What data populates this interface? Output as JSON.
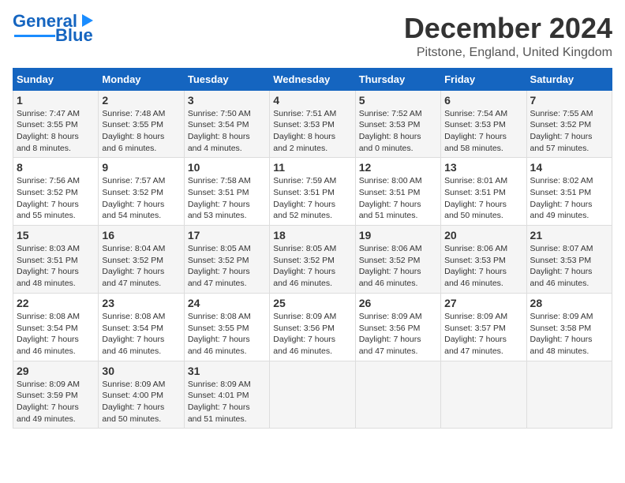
{
  "logo": {
    "line1": "General",
    "line2": "Blue"
  },
  "header": {
    "title": "December 2024",
    "subtitle": "Pitstone, England, United Kingdom"
  },
  "columns": [
    "Sunday",
    "Monday",
    "Tuesday",
    "Wednesday",
    "Thursday",
    "Friday",
    "Saturday"
  ],
  "weeks": [
    [
      {
        "day": "1",
        "lines": [
          "Sunrise: 7:47 AM",
          "Sunset: 3:55 PM",
          "Daylight: 8 hours",
          "and 8 minutes."
        ]
      },
      {
        "day": "2",
        "lines": [
          "Sunrise: 7:48 AM",
          "Sunset: 3:55 PM",
          "Daylight: 8 hours",
          "and 6 minutes."
        ]
      },
      {
        "day": "3",
        "lines": [
          "Sunrise: 7:50 AM",
          "Sunset: 3:54 PM",
          "Daylight: 8 hours",
          "and 4 minutes."
        ]
      },
      {
        "day": "4",
        "lines": [
          "Sunrise: 7:51 AM",
          "Sunset: 3:53 PM",
          "Daylight: 8 hours",
          "and 2 minutes."
        ]
      },
      {
        "day": "5",
        "lines": [
          "Sunrise: 7:52 AM",
          "Sunset: 3:53 PM",
          "Daylight: 8 hours",
          "and 0 minutes."
        ]
      },
      {
        "day": "6",
        "lines": [
          "Sunrise: 7:54 AM",
          "Sunset: 3:53 PM",
          "Daylight: 7 hours",
          "and 58 minutes."
        ]
      },
      {
        "day": "7",
        "lines": [
          "Sunrise: 7:55 AM",
          "Sunset: 3:52 PM",
          "Daylight: 7 hours",
          "and 57 minutes."
        ]
      }
    ],
    [
      {
        "day": "8",
        "lines": [
          "Sunrise: 7:56 AM",
          "Sunset: 3:52 PM",
          "Daylight: 7 hours",
          "and 55 minutes."
        ]
      },
      {
        "day": "9",
        "lines": [
          "Sunrise: 7:57 AM",
          "Sunset: 3:52 PM",
          "Daylight: 7 hours",
          "and 54 minutes."
        ]
      },
      {
        "day": "10",
        "lines": [
          "Sunrise: 7:58 AM",
          "Sunset: 3:51 PM",
          "Daylight: 7 hours",
          "and 53 minutes."
        ]
      },
      {
        "day": "11",
        "lines": [
          "Sunrise: 7:59 AM",
          "Sunset: 3:51 PM",
          "Daylight: 7 hours",
          "and 52 minutes."
        ]
      },
      {
        "day": "12",
        "lines": [
          "Sunrise: 8:00 AM",
          "Sunset: 3:51 PM",
          "Daylight: 7 hours",
          "and 51 minutes."
        ]
      },
      {
        "day": "13",
        "lines": [
          "Sunrise: 8:01 AM",
          "Sunset: 3:51 PM",
          "Daylight: 7 hours",
          "and 50 minutes."
        ]
      },
      {
        "day": "14",
        "lines": [
          "Sunrise: 8:02 AM",
          "Sunset: 3:51 PM",
          "Daylight: 7 hours",
          "and 49 minutes."
        ]
      }
    ],
    [
      {
        "day": "15",
        "lines": [
          "Sunrise: 8:03 AM",
          "Sunset: 3:51 PM",
          "Daylight: 7 hours",
          "and 48 minutes."
        ]
      },
      {
        "day": "16",
        "lines": [
          "Sunrise: 8:04 AM",
          "Sunset: 3:52 PM",
          "Daylight: 7 hours",
          "and 47 minutes."
        ]
      },
      {
        "day": "17",
        "lines": [
          "Sunrise: 8:05 AM",
          "Sunset: 3:52 PM",
          "Daylight: 7 hours",
          "and 47 minutes."
        ]
      },
      {
        "day": "18",
        "lines": [
          "Sunrise: 8:05 AM",
          "Sunset: 3:52 PM",
          "Daylight: 7 hours",
          "and 46 minutes."
        ]
      },
      {
        "day": "19",
        "lines": [
          "Sunrise: 8:06 AM",
          "Sunset: 3:52 PM",
          "Daylight: 7 hours",
          "and 46 minutes."
        ]
      },
      {
        "day": "20",
        "lines": [
          "Sunrise: 8:06 AM",
          "Sunset: 3:53 PM",
          "Daylight: 7 hours",
          "and 46 minutes."
        ]
      },
      {
        "day": "21",
        "lines": [
          "Sunrise: 8:07 AM",
          "Sunset: 3:53 PM",
          "Daylight: 7 hours",
          "and 46 minutes."
        ]
      }
    ],
    [
      {
        "day": "22",
        "lines": [
          "Sunrise: 8:08 AM",
          "Sunset: 3:54 PM",
          "Daylight: 7 hours",
          "and 46 minutes."
        ]
      },
      {
        "day": "23",
        "lines": [
          "Sunrise: 8:08 AM",
          "Sunset: 3:54 PM",
          "Daylight: 7 hours",
          "and 46 minutes."
        ]
      },
      {
        "day": "24",
        "lines": [
          "Sunrise: 8:08 AM",
          "Sunset: 3:55 PM",
          "Daylight: 7 hours",
          "and 46 minutes."
        ]
      },
      {
        "day": "25",
        "lines": [
          "Sunrise: 8:09 AM",
          "Sunset: 3:56 PM",
          "Daylight: 7 hours",
          "and 46 minutes."
        ]
      },
      {
        "day": "26",
        "lines": [
          "Sunrise: 8:09 AM",
          "Sunset: 3:56 PM",
          "Daylight: 7 hours",
          "and 47 minutes."
        ]
      },
      {
        "day": "27",
        "lines": [
          "Sunrise: 8:09 AM",
          "Sunset: 3:57 PM",
          "Daylight: 7 hours",
          "and 47 minutes."
        ]
      },
      {
        "day": "28",
        "lines": [
          "Sunrise: 8:09 AM",
          "Sunset: 3:58 PM",
          "Daylight: 7 hours",
          "and 48 minutes."
        ]
      }
    ],
    [
      {
        "day": "29",
        "lines": [
          "Sunrise: 8:09 AM",
          "Sunset: 3:59 PM",
          "Daylight: 7 hours",
          "and 49 minutes."
        ]
      },
      {
        "day": "30",
        "lines": [
          "Sunrise: 8:09 AM",
          "Sunset: 4:00 PM",
          "Daylight: 7 hours",
          "and 50 minutes."
        ]
      },
      {
        "day": "31",
        "lines": [
          "Sunrise: 8:09 AM",
          "Sunset: 4:01 PM",
          "Daylight: 7 hours",
          "and 51 minutes."
        ]
      },
      {
        "day": "",
        "lines": []
      },
      {
        "day": "",
        "lines": []
      },
      {
        "day": "",
        "lines": []
      },
      {
        "day": "",
        "lines": []
      }
    ]
  ]
}
